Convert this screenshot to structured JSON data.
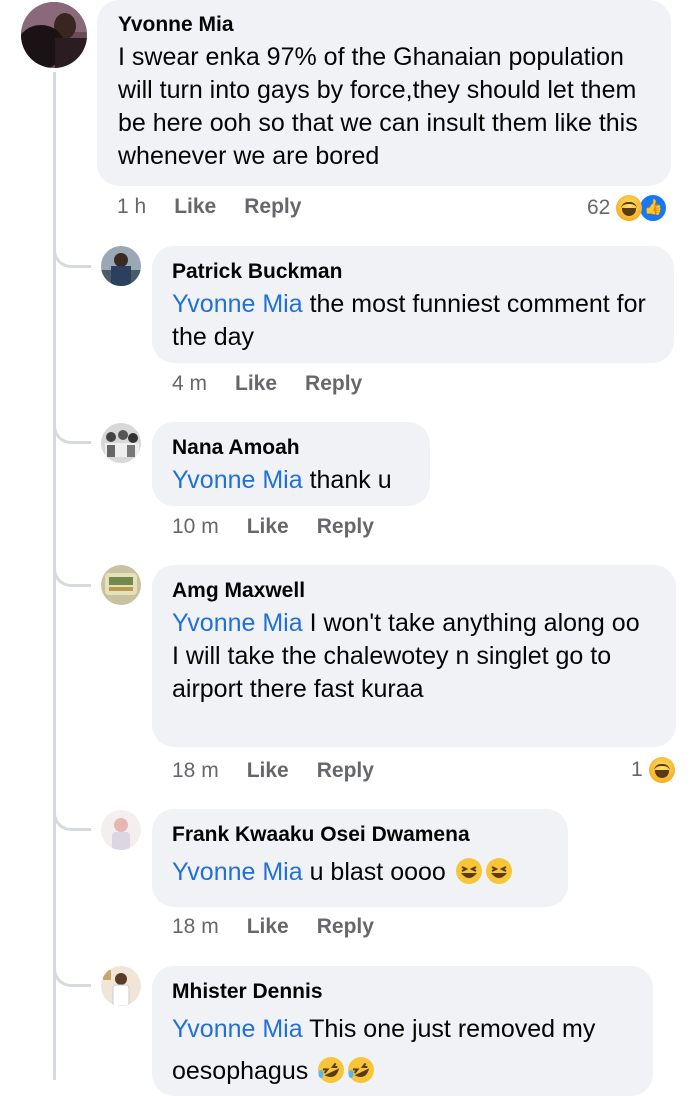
{
  "comments": [
    {
      "author": "Yvonne Mia",
      "mention": "",
      "text": "I swear enka 97% of the Ghanaian population will turn into gays by force,they should let them be here  ooh so that we can insult them like this whenever we are bored",
      "time": "1 h",
      "like": "Like",
      "reply": "Reply",
      "reaction_count": "62",
      "reactions": [
        "haha-icon",
        "like-icon"
      ]
    },
    {
      "author": "Patrick Buckman",
      "mention": "Yvonne Mia",
      "text": " the most funniest comment for the day",
      "time": "4 m",
      "like": "Like",
      "reply": "Reply"
    },
    {
      "author": "Nana Amoah",
      "mention": "Yvonne Mia",
      "text": " thank u",
      "time": "10 m",
      "like": "Like",
      "reply": "Reply"
    },
    {
      "author": "Amg Maxwell",
      "mention": "Yvonne Mia",
      "text": " I won't take anything along oo",
      "text2": "I will take the chalewotey n singlet go to airport there fast kuraa",
      "time": "18 m",
      "like": "Like",
      "reply": "Reply",
      "reaction_count": "1",
      "reactions": [
        "haha-icon"
      ]
    },
    {
      "author": "Frank Kwaaku Osei Dwamena",
      "mention": "Yvonne Mia",
      "text": " u blast oooo ",
      "emojis": [
        "grinning-squinting-face-icon",
        "grinning-squinting-face-icon"
      ],
      "time": "18 m",
      "like": "Like",
      "reply": "Reply"
    },
    {
      "author": "Mhister Dennis",
      "mention": "Yvonne Mia",
      "text": " This one just removed my oesophagus ",
      "emojis": [
        "rolling-on-floor-laughing-icon",
        "rolling-on-floor-laughing-icon"
      ]
    }
  ],
  "colors": {
    "mention": "#216fdb",
    "bubble": "#f0f2f5",
    "meta": "#65676b",
    "like_blue": "#1877f2"
  }
}
